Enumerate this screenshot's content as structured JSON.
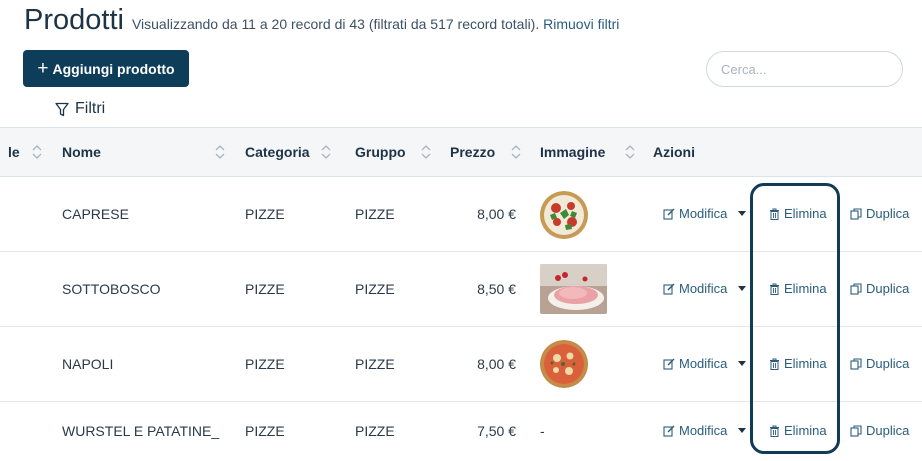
{
  "page": {
    "title": "Prodotti",
    "subtitle": "Visualizzando da 11 a 20 record di 43 (filtrati da 517 record totali).",
    "clear_filters": "Rimuovi filtri"
  },
  "toolbar": {
    "add_label": "Aggiungi prodotto",
    "filters_label": "Filtri",
    "search_placeholder": "Cerca..."
  },
  "table": {
    "columns": {
      "partial": "le",
      "name": "Nome",
      "category": "Categoria",
      "group": "Gruppo",
      "price": "Prezzo",
      "image": "Immagine",
      "actions": "Azioni"
    },
    "rows": [
      {
        "name": "CAPRESE",
        "category": "PIZZE",
        "group": "PIZZE",
        "price": "8,00 €",
        "image": "caprese-pizza"
      },
      {
        "name": "SOTTOBOSCO",
        "category": "PIZZE",
        "group": "PIZZE",
        "price": "8,50 €",
        "image": "sottobosco-pizza"
      },
      {
        "name": "NAPOLI",
        "category": "PIZZE",
        "group": "PIZZE",
        "price": "8,00 €",
        "image": "napoli-pizza"
      },
      {
        "name": "WURSTEL E PATATINE_",
        "category": "PIZZE",
        "group": "PIZZE",
        "price": "7,50 €",
        "image_text": "-"
      }
    ],
    "actions": {
      "edit": "Modifica",
      "delete": "Elimina",
      "duplicate": "Duplica"
    }
  },
  "icons": [
    "plus-icon",
    "filter-icon",
    "sort-icon",
    "edit-icon",
    "caret-down-icon",
    "trash-icon",
    "copy-icon"
  ],
  "colors": {
    "primary": "#0d3d59",
    "link": "#2a5d7d",
    "header_bg": "#f4f6f8",
    "highlight": "#123c55"
  }
}
